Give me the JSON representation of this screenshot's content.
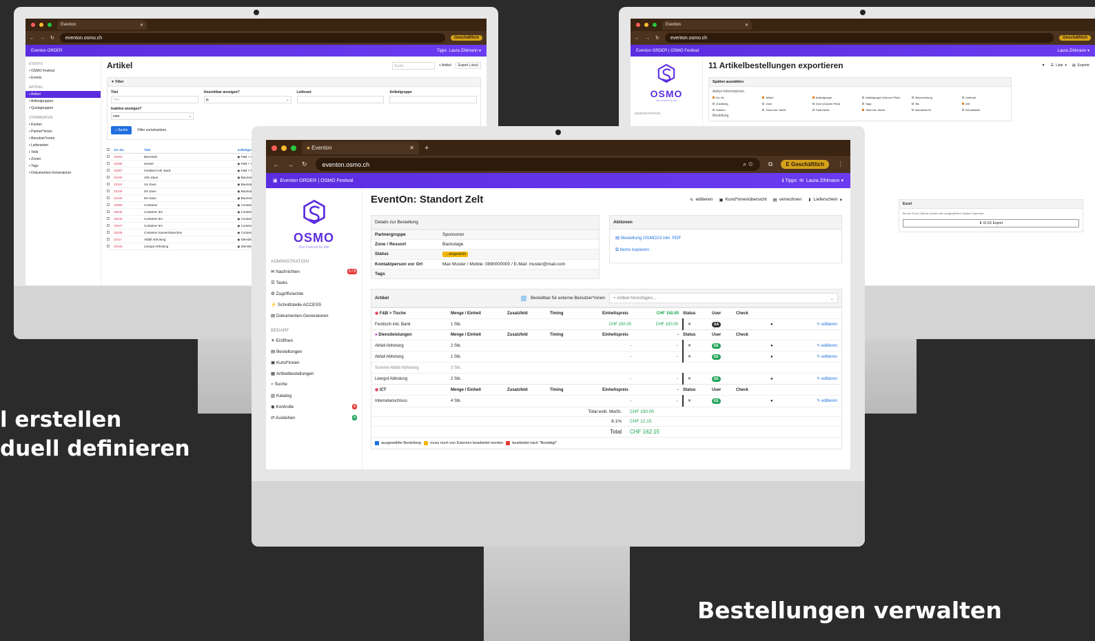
{
  "captions": {
    "left_line1": "l erstellen",
    "left_line2": "duell definieren",
    "right": "Bestellungen verwalten"
  },
  "browser": {
    "tab_title": "Eventon",
    "url": "eventon.osmo.ch",
    "profile": "Geschäftlich",
    "profile_initial": "E"
  },
  "app": {
    "brand_left": "Eventon ORDER",
    "brand_full": "Eventon ORDER | OSMO Festival",
    "tips": "Tipps",
    "user": "Laura Zihlmann",
    "logo_text": "OSMO",
    "logo_sub": "Das Festival für alle"
  },
  "left_screen": {
    "side_events_sec": "EVENTS",
    "side_events": [
      "OSMO Festival",
      "Events"
    ],
    "side_artikel_sec": "ARTIKEL",
    "side_artikel": [
      "Artikel",
      "Artikelgruppen",
      "Quotagruppen"
    ],
    "side_stamm_sec": "STAMMDATEN",
    "side_stamm": [
      "Konten",
      "Partner*innen",
      "Benutzer*innen",
      "Lieferanten",
      "Teile",
      "Zonen",
      "Tags",
      "Dokumenten-Generatoren"
    ],
    "title": "Artikel",
    "search_placeholder": "Suche",
    "btn_artikel": "+ Artikel",
    "btn_export": "Export (.xlsx)",
    "filter_title": "Filter",
    "f_titel": "Titel",
    "f_titel_ph": "Titel",
    "f_unsichtbar": "Unsichtbar anzeigen?",
    "f_unsichtbar_val": "ja",
    "f_lieferant": "Lieferant",
    "f_gruppe": "Artikelgruppe",
    "f_inaktive": "Inaktive anzeigen?",
    "f_inaktive_val": "nein",
    "btn_suche": "Suche",
    "btn_reset": "Filter zurücksetzen",
    "cols": [
      "Art.-Nr.",
      "Titel",
      "Artikelgruppe"
    ],
    "rows": [
      [
        "33093",
        "Bürostuhl",
        "F&B > Stühle"
      ],
      [
        "33095",
        "Sessel",
        "F&B > Stühle"
      ],
      [
        "33097",
        "Festtisch inkl. Bank",
        "F&B > Tische"
      ],
      [
        "33105",
        "10m Zaun",
        "Baumaterial > Zaun"
      ],
      [
        "33118",
        "1m Zaun",
        "Baumaterial > Zaun"
      ],
      [
        "33108",
        "2m Zaun",
        "Baumaterial > Zaun"
      ],
      [
        "33109",
        "5m Zaun",
        "Baumaterial > Zaun"
      ],
      [
        "33085",
        "Container",
        "Container > Container-Extra"
      ],
      [
        "33048",
        "Container 3m",
        "Container > Container spe"
      ],
      [
        "33045",
        "Container 5m",
        "Container > Container spe"
      ],
      [
        "33047",
        "Container 6m",
        "Container > Container spe"
      ],
      [
        "33038",
        "Container Kassenhäuschen",
        "Container > Container spe"
      ],
      [
        "33117",
        "Abfall Abholung",
        "Dienstleistungen"
      ],
      [
        "33106",
        "Leergut Abholung",
        "Dienstleistungen"
      ]
    ]
  },
  "right_screen": {
    "title": "11 Artikelbestellungen exportieren",
    "btn_liste": "Liste",
    "btn_exporte": "Exporte",
    "spalten": "Spalten auswählen",
    "artikel_info": "Artikel-Informationen",
    "bestellung": "Bestellung",
    "admin": "ADMINISTRATION",
    "cols": [
      "Art.-Nr.",
      "Artikel",
      "Artikelgruppe",
      "Artikelgruppe (Ganzer Pfad)",
      "Beschreibung",
      "Lieferant",
      "Zuständig",
      "Zone",
      "Zone (Ganzer Pfad)",
      "Tags",
      "Bis",
      "Zeit",
      "Notizen",
      "Total exkl. MwSt.",
      "Total MwSt.",
      "Total inkl. MwSt.",
      "Bearbeiter*in",
      "Schnittstelle"
    ],
    "excel_title": "Excel",
    "excel_text": "Bei der Excel-Tabelle werden alle ausgewählten Spalten exportiert.",
    "excel_btn": "XLSX Export"
  },
  "main_screen": {
    "side_admin_sec": "ADMINISTRATION",
    "side_admin": [
      {
        "icon": "envelope-icon",
        "glyph": "✉",
        "label": "Nachrichten",
        "badge": "1 / 3"
      },
      {
        "icon": "list-icon",
        "glyph": "☰",
        "label": "Tasks",
        "badge": ""
      },
      {
        "icon": "gear-icon",
        "glyph": "⚙",
        "label": "Zugriffsrechte",
        "badge": ""
      },
      {
        "icon": "plug-icon",
        "glyph": "⚡",
        "label": "Schnittstelle ACCESS",
        "badge": ""
      },
      {
        "icon": "doc-icon",
        "glyph": "▤",
        "label": "Dokumenten-Generatoren",
        "badge": ""
      }
    ],
    "side_bedarf_sec": "BEDARF",
    "side_bedarf": [
      {
        "icon": "sun-icon",
        "glyph": "☀",
        "label": "Eröffnen",
        "badge": "",
        "color": ""
      },
      {
        "icon": "list-icon",
        "glyph": "▤",
        "label": "Bestellungen",
        "badge": "",
        "color": ""
      },
      {
        "icon": "card-icon",
        "glyph": "▣",
        "label": "Kund*innen",
        "badge": "",
        "color": ""
      },
      {
        "icon": "grid-icon",
        "glyph": "▦",
        "label": "Artikelbestellungen",
        "badge": "",
        "color": ""
      },
      {
        "icon": "search-icon",
        "glyph": "⌕",
        "label": "Suche",
        "badge": "",
        "color": ""
      },
      {
        "icon": "book-icon",
        "glyph": "▥",
        "label": "Katalog",
        "badge": "",
        "color": ""
      },
      {
        "icon": "check-icon",
        "glyph": "◉",
        "label": "Kontrolle",
        "badge": "5",
        "color": "#e53935"
      },
      {
        "icon": "swap-icon",
        "glyph": "⇄",
        "label": "Ausleihen",
        "badge": "0",
        "color": "#22a35a"
      }
    ],
    "title": "EventOn: Standort Zelt",
    "actions": [
      "editieren",
      "Kund*innenübersicht",
      "verrechnen",
      "Lieferschein"
    ],
    "details_title": "Details zur Bestellung",
    "details": [
      {
        "k": "Partnergruppe",
        "v": "Sponsoren"
      },
      {
        "k": "Zone / Ressort",
        "v": "Backstage"
      },
      {
        "k": "Status",
        "v": "eingereicht"
      },
      {
        "k": "Kontaktperson vor Ort",
        "v": "Max Muster / Mobile: 0890000000 / E-Mail: muster@mail.com"
      },
      {
        "k": "Tags",
        "v": ""
      }
    ],
    "aktionen_title": "Aktionen",
    "aktion1": "Bestellung OSMO23 inkl. PDF",
    "aktion2": "Items kopieren",
    "artikel_title": "Artikel",
    "extern_label": "Bestellbar für externe Benutzer*innen",
    "add_placeholder": "+ Artikel hinzufügen...",
    "col_menge": "Menge / Einheit",
    "col_zusatz": "Zusatzfeld",
    "col_timing": "Timing",
    "col_preis": "Einheitspreis",
    "col_status": "Status",
    "col_user": "User",
    "col_check": "Check",
    "groups": [
      {
        "name": "F&B > Tische",
        "color": "#e03a5a",
        "ring": true,
        "total": "CHF 150.00",
        "rows": [
          {
            "title": "Festtisch inkl. Bank",
            "menge": "1 Stk.",
            "preis": "CHF 150.00",
            "sum": "CHF 150.00",
            "user": "AA",
            "dark": true
          }
        ]
      },
      {
        "name": "Dienstleistungen",
        "color": "#a21caf",
        "ring": false,
        "total": "-",
        "rows": [
          {
            "title": "Abfall Abholung",
            "menge": "2 Stk.",
            "preis": "-",
            "sum": "-",
            "user": "EE",
            "dark": false
          },
          {
            "title": "Abfall Abholung",
            "menge": "1 Stk.",
            "preis": "-",
            "sum": "-",
            "user": "EE",
            "dark": false
          },
          {
            "title": "Summe Abfall Abholung",
            "menge": "3 Stk.",
            "preis": "",
            "sum": "",
            "user": "",
            "dark": false,
            "summe": true
          },
          {
            "title": "Leergut Abholung",
            "menge": "2 Stk.",
            "preis": "-",
            "sum": "-",
            "user": "EE",
            "dark": false
          }
        ]
      },
      {
        "name": "ICT",
        "color": "#e03a5a",
        "ring": true,
        "total": "-",
        "rows": [
          {
            "title": "Internetanschluss",
            "menge": "4 Stk.",
            "preis": "-",
            "sum": "-",
            "user": "EE",
            "dark": false
          }
        ]
      }
    ],
    "editieren": "editieren",
    "totals": [
      {
        "label": "Total exkl. MwSt.",
        "value": "CHF 150.00"
      },
      {
        "label": "8.1%",
        "value": "CHF 12.15"
      },
      {
        "label": "Total",
        "value": "CHF 162.15"
      }
    ],
    "legend": [
      {
        "color": "#1f6fe0",
        "label": "ausgewählte Bestellung"
      },
      {
        "color": "#f2b705",
        "label": "muss noch von Externen bearbeitet werden"
      },
      {
        "color": "#e53935",
        "label": "bearbeitet nach \"Bestätigt\""
      }
    ]
  }
}
